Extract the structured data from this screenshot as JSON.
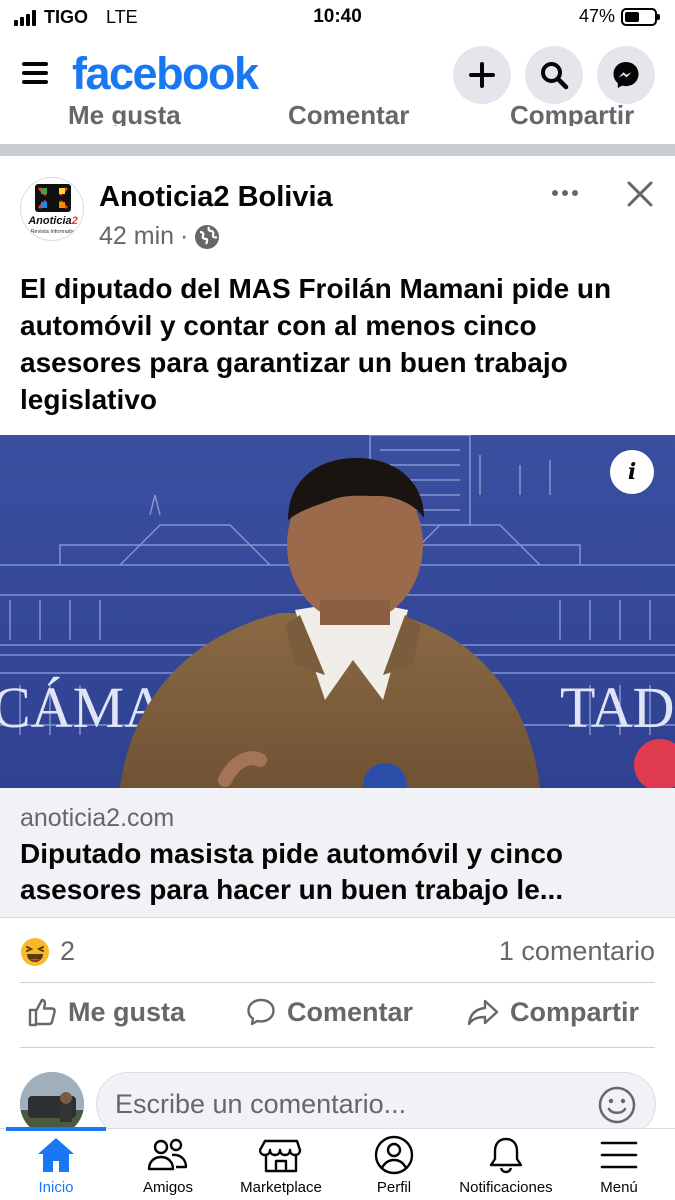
{
  "status_bar": {
    "carrier": "TIGO",
    "network": "LTE",
    "time": "10:40",
    "battery": "47%",
    "battery_level": 0.47
  },
  "header": {
    "logo": "facebook",
    "icons": [
      "menu-icon",
      "plus-icon",
      "search-icon",
      "messenger-icon"
    ]
  },
  "prev_post_actions": [
    "Me gusta",
    "Comentar",
    "Compartir"
  ],
  "post": {
    "page_name": "Anoticia2 Bolivia",
    "avatar_text": "Anoticia2",
    "avatar_subtext": "Revista Informativa",
    "time": "42 min",
    "separator": "·",
    "text": "El diputado del MAS Froilán Mamani pide un automóvil y contar con al menos cinco asesores para garantizar un buen trabajo legislativo",
    "image_overlay_text_left": "CÁMA",
    "image_overlay_text_right": "TADO",
    "info_button": "i",
    "link_domain": "anoticia2.com",
    "link_title": "Diputado masista pide automóvil y cinco asesores para hacer un buen trabajo le...",
    "reaction_count": "2",
    "comments_count": "1 comentario",
    "actions": {
      "like": "Me gusta",
      "comment": "Comentar",
      "share": "Compartir"
    }
  },
  "composer": {
    "placeholder": "Escribe un comentario..."
  },
  "tabbar": [
    {
      "label": "Inicio",
      "active": true
    },
    {
      "label": "Amigos",
      "active": false
    },
    {
      "label": "Marketplace",
      "active": false
    },
    {
      "label": "Perfil",
      "active": false
    },
    {
      "label": "Notificaciones",
      "active": false
    },
    {
      "label": "Menú",
      "active": false
    }
  ],
  "colors": {
    "brand": "#1877f2",
    "secondary_text": "#65676b",
    "divider": "#c9ccd1"
  }
}
